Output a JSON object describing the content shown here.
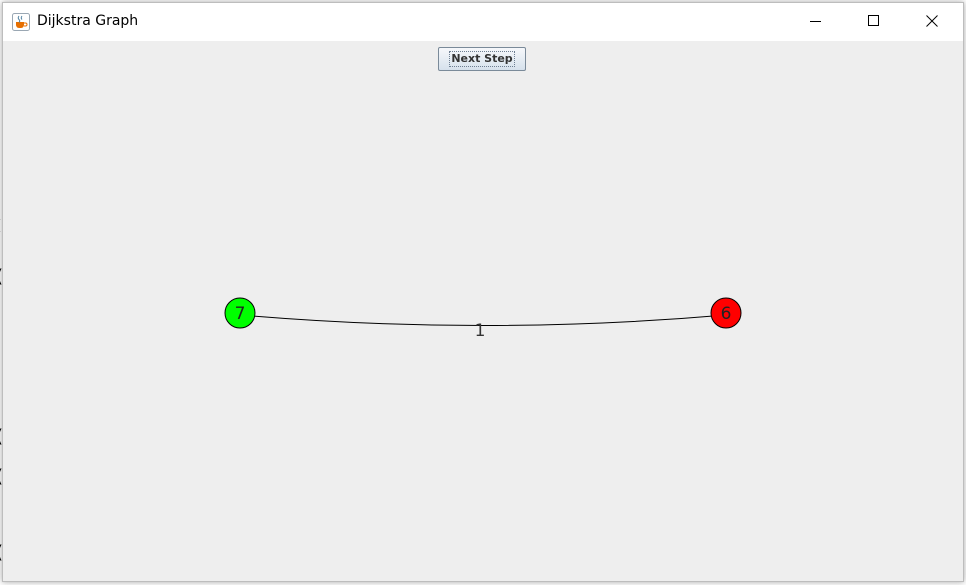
{
  "window": {
    "title": "Dijkstra Graph",
    "icon": "java-cup-icon"
  },
  "toolbar": {
    "next_step_label": "Next Step"
  },
  "graph": {
    "nodes": [
      {
        "id": "7",
        "label": "7",
        "color": "#00ff00"
      },
      {
        "id": "6",
        "label": "6",
        "color": "#ff0000"
      }
    ],
    "edges": [
      {
        "from": "7",
        "to": "6",
        "weight": "1"
      }
    ]
  },
  "background_glyphs": [
    "(",
    "(",
    "l",
    "(",
    "(",
    "l",
    "("
  ],
  "colors": {
    "content_bg": "#eeeeee",
    "titlebar_bg": "#ffffff",
    "node_start": "#00ff00",
    "node_end": "#ff0000"
  }
}
